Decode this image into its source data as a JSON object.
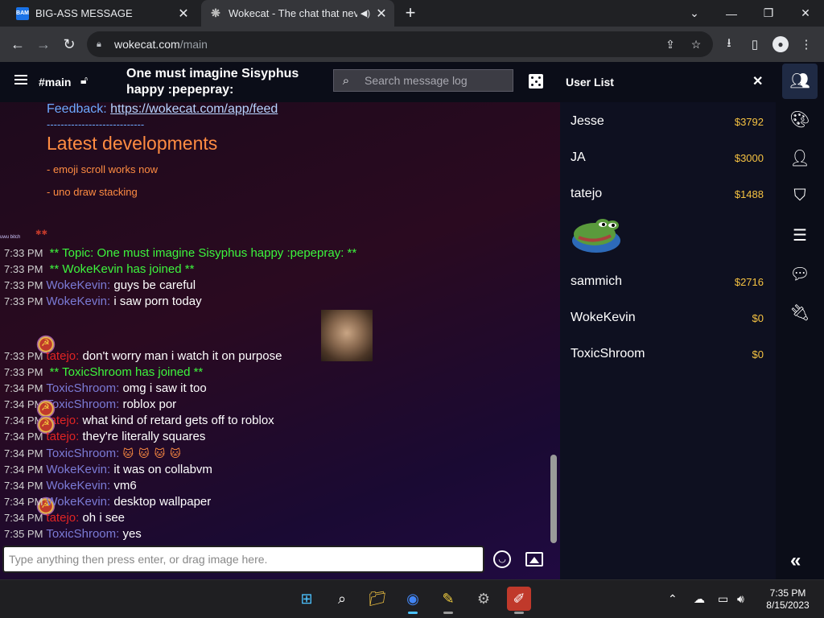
{
  "browser": {
    "tabs": [
      {
        "label": "BIG-ASS MESSAGE",
        "favicon": "BAM"
      },
      {
        "label": "Wokecat - The chat that nev",
        "favicon": "cat-icon"
      }
    ],
    "address": {
      "host": "wokecat.com",
      "path": "/main"
    }
  },
  "header": {
    "channel": "#main",
    "topic": "One must imagine Sisyphus happy :pepepray:",
    "search_placeholder": "Search message log"
  },
  "chat": {
    "feedback_label": "Feedback: ",
    "feedback_link": "https://wokecat.com/app/feed",
    "dashes": "----------------------------",
    "dev_title": "Latest developments",
    "dev_items": [
      "- emoji scroll works now",
      "- uno draw stacking"
    ],
    "tiny_note": "uwu bitch",
    "messages": [
      {
        "time": "7:33 PM",
        "system": "** Topic: One must imagine Sisyphus happy :pepepray: **"
      },
      {
        "time": "7:33 PM",
        "system": "** WokeKevin has joined **"
      },
      {
        "time": "7:33 PM",
        "nick": "WokeKevin:",
        "text": "guys be careful"
      },
      {
        "time": "7:33 PM",
        "nick": "WokeKevin:",
        "text": "i saw porn today"
      },
      {
        "time": "7:33 PM",
        "nick": "tatejo:",
        "text": "don't worry man i watch it on purpose"
      },
      {
        "time": "7:33 PM",
        "system": "** ToxicShroom has joined **"
      },
      {
        "time": "7:34 PM",
        "nick": "ToxicShroom:",
        "text": "omg i saw it too"
      },
      {
        "time": "7:34 PM",
        "nick": "ToxicShroom:",
        "text": "roblox por"
      },
      {
        "time": "7:34 PM",
        "nick": "tatejo:",
        "text": "what kind of retard gets off to roblox"
      },
      {
        "time": "7:34 PM",
        "nick": "tatejo:",
        "text": "they're literally squares"
      },
      {
        "time": "7:34 PM",
        "nick": "ToxicShroom:",
        "text": ""
      },
      {
        "time": "7:34 PM",
        "nick": "WokeKevin:",
        "text": "it was on collabvm"
      },
      {
        "time": "7:34 PM",
        "nick": "WokeKevin:",
        "text": "vm6"
      },
      {
        "time": "7:34 PM",
        "nick": "WokeKevin:",
        "text": "desktop wallpaper"
      },
      {
        "time": "7:34 PM",
        "nick": "tatejo:",
        "text": "oh i see"
      },
      {
        "time": "7:35 PM",
        "nick": "ToxicShroom:",
        "text": "yes"
      }
    ],
    "composer_placeholder": "Type anything then press enter, or drag image here."
  },
  "users": {
    "title": "User List",
    "list": [
      {
        "name": "Jesse",
        "money": "$3792"
      },
      {
        "name": "JA",
        "money": "$3000"
      },
      {
        "name": "tatejo",
        "money": "$1488"
      },
      {
        "name": "sammich",
        "money": "$2716"
      },
      {
        "name": "WokeKevin",
        "money": "$0"
      },
      {
        "name": "ToxicShroom",
        "money": "$0"
      }
    ]
  },
  "sidebar_icons": [
    "users-icon",
    "palette-icon",
    "user-icon",
    "shield-icon",
    "sliders-icon",
    "chat-icon",
    "plug-icon",
    "collapse-icon"
  ],
  "taskbar": {
    "time": "7:35 PM",
    "date": "8/15/2023"
  },
  "colors": {
    "system": "#3df53d",
    "nick_blue": "#7b7bd6",
    "nick_red": "#e02424",
    "money": "#f5c242",
    "dev_orange": "#ff8c42"
  }
}
